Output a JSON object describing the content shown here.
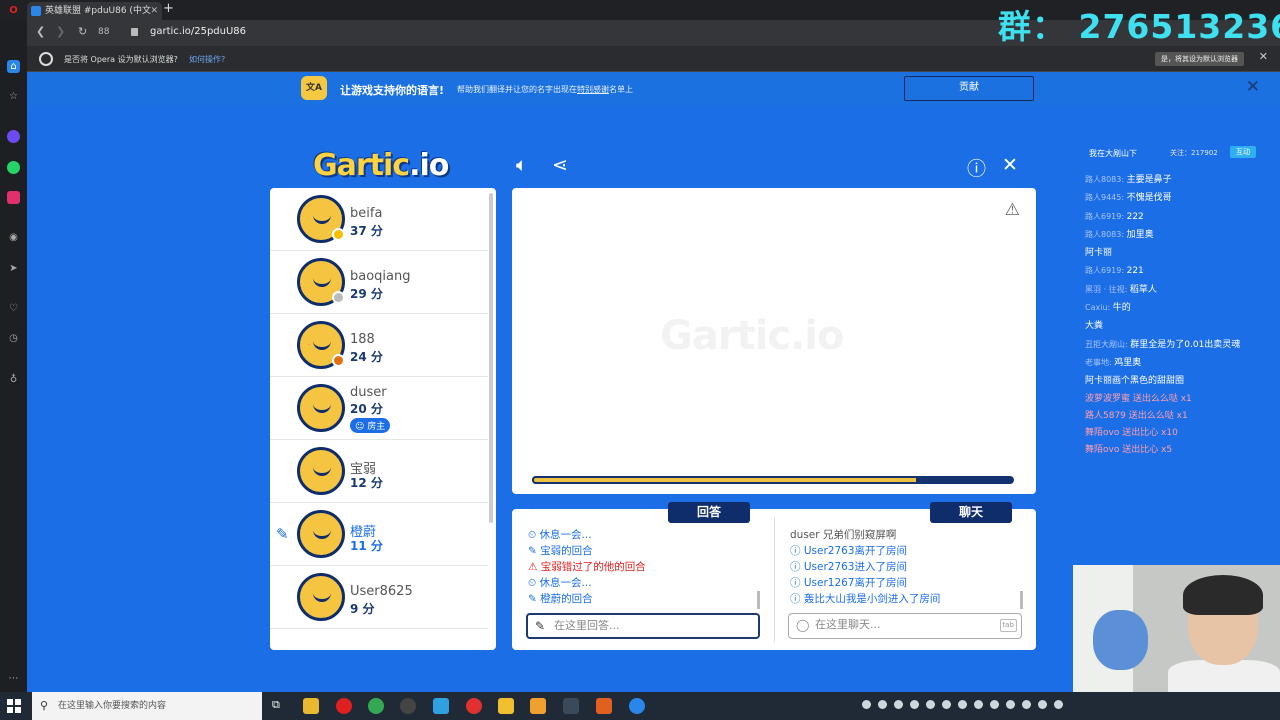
{
  "browser": {
    "tab_title": "英雄联盟 #pduU86 (中文",
    "url": "gartic.io/25pduU86",
    "nav_count": "88",
    "infobar_text": "是否将 Opera 设为默认浏览器?",
    "infobar_link": "如何操作?",
    "infobar_button": "是，将其设为默认浏览器"
  },
  "overlay_group": "群： 276513236",
  "banner": {
    "icon_text": "文A",
    "title": "让游戏支持你的语言!",
    "subtitle": "帮助我们翻译并让您的名字出现在",
    "subtitle_link": "特别感谢",
    "subtitle_tail": "名单上",
    "button": "贡献"
  },
  "game": {
    "logo_main": "Gartic",
    "logo_io": ".io",
    "watermark": "Gartic.io",
    "timer_fraction": 0.8,
    "players": [
      {
        "name": "beifa",
        "score": "37 分",
        "dot": "#f5c000"
      },
      {
        "name": "baoqiang",
        "score": "29 分",
        "dot": "#bbbbbb"
      },
      {
        "name": "188",
        "score": "24 分",
        "dot": "#e07010"
      },
      {
        "name": "duser",
        "score": "20 分",
        "badge": "房主"
      },
      {
        "name": "宝弱",
        "score": "12 分"
      },
      {
        "name": "橙蔚",
        "score": "11 分",
        "drawing": true
      },
      {
        "name": "User8625",
        "score": "9 分"
      }
    ],
    "answer_tab": "回答",
    "chat_tab": "聊天",
    "answer_msgs": [
      {
        "text": "休息一会...",
        "cls": "blue",
        "icon": "⏲"
      },
      {
        "text": "宝弱的回合",
        "cls": "blue",
        "icon": "✎"
      },
      {
        "text": "宝弱错过了的他的回合",
        "cls": "red",
        "icon": "⚠"
      },
      {
        "text": "休息一会...",
        "cls": "blue",
        "icon": "⏲"
      },
      {
        "text": "橙蔚的回合",
        "cls": "blue",
        "icon": "✎"
      }
    ],
    "chat_msgs": [
      {
        "text": "duser 兄弟们别窥屏啊",
        "cls": "gray",
        "icon": ""
      },
      {
        "text": "User2763离开了房间",
        "cls": "blue",
        "icon": "ⓘ"
      },
      {
        "text": "User2763进入了房间",
        "cls": "blue",
        "icon": "ⓘ"
      },
      {
        "text": "User1267离开了房间",
        "cls": "blue",
        "icon": "ⓘ"
      },
      {
        "text": "轰比大山我是小剑进入了房间",
        "cls": "blue",
        "icon": "ⓘ"
      }
    ],
    "answer_placeholder": "在这里回答...",
    "chat_placeholder": "在这里聊天...",
    "chat_tab_key": "tab"
  },
  "stream": {
    "streamer": "我在大剐山下",
    "followers": "关注：217902",
    "follow_btn": "互动",
    "messages": [
      {
        "user": "路人8083:",
        "text": "主要是鼻子"
      },
      {
        "user": "路人9445:",
        "text": "不愧是伐哥"
      },
      {
        "user": "路人6919:",
        "text": "222"
      },
      {
        "user": "路人8083:",
        "text": "加里奥"
      },
      {
        "user": "",
        "text": "阿卡丽"
      },
      {
        "user": "路人6919:",
        "text": "221"
      },
      {
        "user": "黑羽 · 往视:",
        "text": "稻草人"
      },
      {
        "user": "Caxiu:",
        "text": "牛的"
      },
      {
        "user": "",
        "text": "大粪"
      },
      {
        "user": "丑拒大剐山:",
        "text": "群里全是为了0.01出卖灵魂"
      },
      {
        "user": "老事地:",
        "text": "鸡里奥"
      },
      {
        "user": "",
        "text": "阿卡丽画个黑色的甜甜圈"
      }
    ],
    "gifts": [
      {
        "text": "波萝波罗蜜 送出么么哒 x1"
      },
      {
        "text": "路人5879 送出么么哒 x1"
      },
      {
        "text": "舞陌ovo 送出比心 x10"
      },
      {
        "text": "舞陌ovo 送出比心 x5"
      }
    ]
  },
  "taskbar": {
    "search_placeholder": "在这里输入你要搜索的内容"
  }
}
